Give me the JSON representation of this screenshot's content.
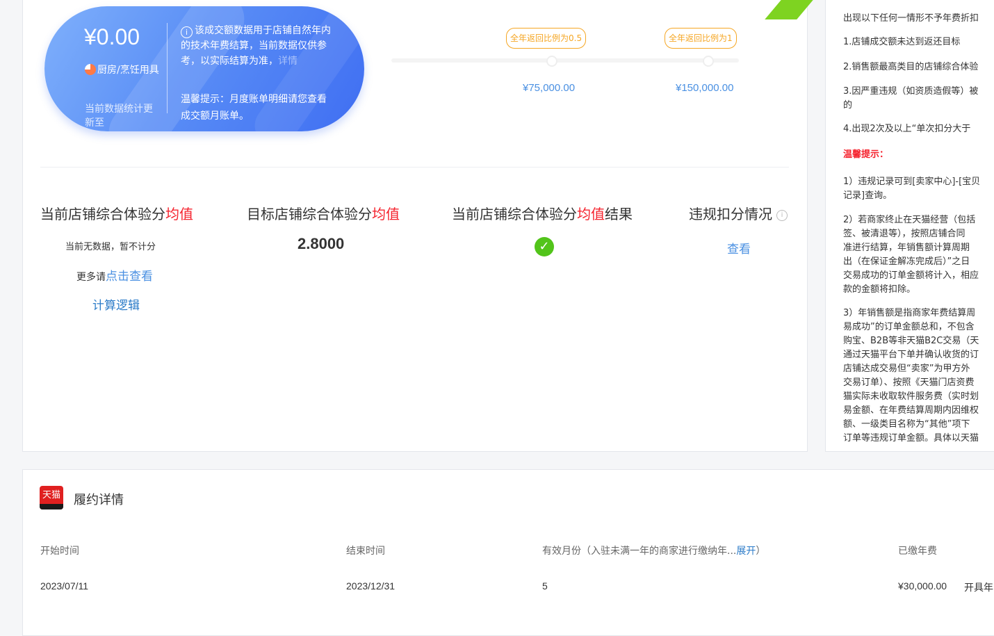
{
  "card": {
    "amount": "¥0.00",
    "category": "厨房/烹饪用具",
    "update": "当前数据统计更新至",
    "info": "该成交额数据用于店铺自然年内的技术年费结算，当前数据仅供参考，以实际结算为准，",
    "info_more": "详情",
    "info_icon": "info-icon",
    "tip": "温馨提示：月度账单明细请您查看成交额月账单。"
  },
  "milestones": [
    {
      "bubble": "全年返回比例为0.5",
      "amount": "¥75,000.00"
    },
    {
      "bubble": "全年返回比例为1",
      "amount": "¥150,000.00"
    }
  ],
  "metrics": {
    "current_label_a": "当前店铺综合体验分",
    "current_label_b": "均值",
    "current_nodata": "当前无数据，暂不计分",
    "current_more": "更多请",
    "current_more_link": "点击查看",
    "calc_logic": "计算逻辑",
    "target_label_a": "目标店铺综合体验分",
    "target_label_b": "均值",
    "target_value": "2.8000",
    "result_label_a": "当前店铺综合体验分",
    "result_label_b": "均值",
    "result_label_c": "结果",
    "result_icon": "check-icon",
    "violation_label": "违规扣分情况",
    "violation_link": "查看"
  },
  "side": {
    "intro": "出现以下任何一情形不予年费折扣",
    "rule1": "1.店铺成交额未达到返还目标",
    "rule2": "2.销售额最高类目的店铺综合体验",
    "rule3a": "3.因严重违规（如资质造假等）被",
    "rule3b": "的",
    "rule4": "4.出现2次及以上“单次扣分大于",
    "tip_title": "温馨提示：",
    "t1a": "1）违规记录可到[卖家中心]-[宝贝",
    "t1b": "记录]查询。",
    "t2a": "2）若商家终止在天猫经营（包括",
    "t2b": "签、被清退等），按照店铺合同",
    "t2c": "准进行结算，年销售额计算周期",
    "t2d": "出（在保证金解冻完成后）”之日",
    "t2e": "交易成功的订单金额将计入，相应",
    "t2f": "款的金额将扣除。",
    "t3a": "3）年销售额是指商家年费结算周",
    "t3b": "易成功”的订单金额总和，不包含",
    "t3c": "购宝、B2B等非天猫B2C交易（天",
    "t3d": "通过天猫平台下单并确认收货的订",
    "t3e": "店铺达成交易但“卖家”为甲方外",
    "t3f": "交易订单）、按照《天猫门店资费",
    "t3g": "猫实际未收取软件服务费（实时划",
    "t3h": "易金额、在年费结算周期内因维权",
    "t3i": "额、一级类目名称为“其他”项下",
    "t3j": "订单等违规订单金额。具体以天猫"
  },
  "fulfillment": {
    "logo_text": "天猫",
    "title": "履约详情",
    "headers": {
      "start": "开始时间",
      "end": "结束时间",
      "months": "有效月份（入驻未满一年的商家进行缴纳年...",
      "expand": "展开",
      "close_paren": "）",
      "paid": "已缴年费"
    },
    "row": {
      "start": "2023/07/11",
      "end": "2023/12/31",
      "months": "5",
      "paid": "¥30,000.00",
      "action": "开具年"
    }
  },
  "colors": {
    "accent_blue": "#4a90e2",
    "highlight_red": "#f5222d",
    "bubble_orange": "#f5a623",
    "success_green": "#52c41a"
  }
}
